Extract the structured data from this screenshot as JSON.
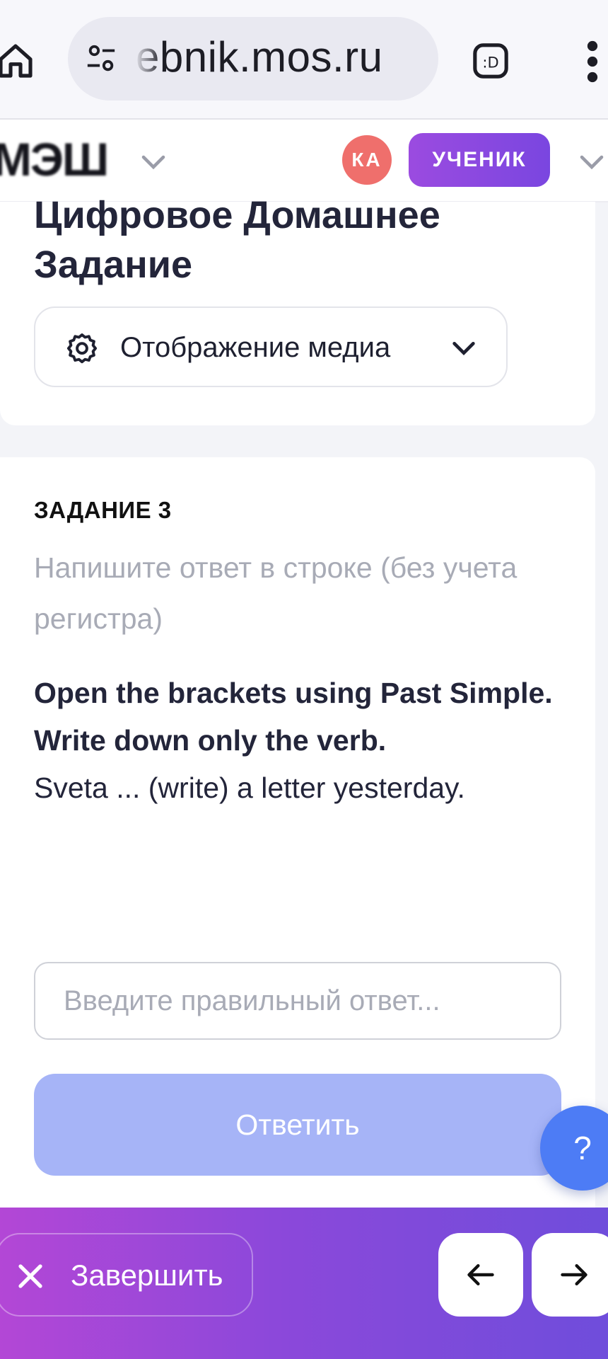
{
  "browser": {
    "url": "ebnik.mos.ru"
  },
  "header": {
    "logo": "МЭШ",
    "avatar_initials": "КА",
    "role_badge": "УЧЕНИК"
  },
  "title_card": {
    "title": "Цифровое Домашнее Задание",
    "media_dropdown_label": "Отображение медиа"
  },
  "task": {
    "number_label": "ЗАДАНИЕ 3",
    "instruction": "Напишите ответ в строке (без учета регистра)",
    "question_bold": "Open the brackets using Past Simple. Write down only the verb.",
    "question_text": "Sveta ... (write) a letter yesterday.",
    "answer_placeholder": "Введите правильный ответ...",
    "answer_value": "",
    "submit_label": "Ответить"
  },
  "help": {
    "label": "?"
  },
  "bottom_bar": {
    "finish_label": "Завершить"
  },
  "colors": {
    "accent_purple": "#8c48da",
    "avatar_red": "#ef6f6c",
    "submit_disabled": "#a6b4f7",
    "help_blue": "#4d7cf5"
  },
  "icons": [
    "home-icon",
    "tune-icon",
    "extension-icon",
    "more-vert-icon",
    "chevron-down-icon",
    "gear-icon",
    "close-icon",
    "arrow-left-icon",
    "arrow-right-icon"
  ]
}
